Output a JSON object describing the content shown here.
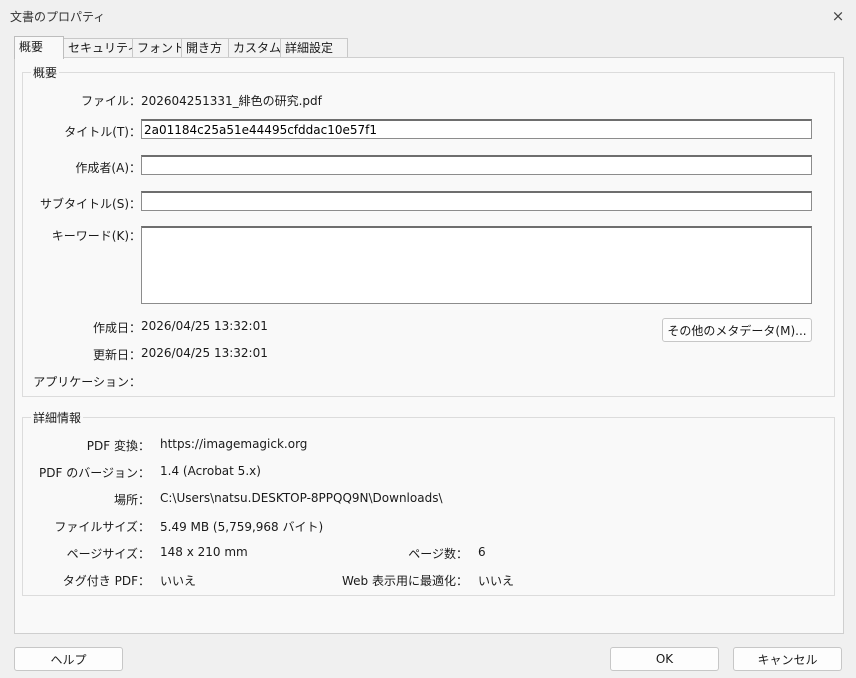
{
  "window": {
    "title": "文書のプロパティ",
    "close_icon": "×"
  },
  "tabs": [
    {
      "label": "概要"
    },
    {
      "label": "セキュリティ"
    },
    {
      "label": "フォント"
    },
    {
      "label": "開き方"
    },
    {
      "label": "カスタム"
    },
    {
      "label": "詳細設定"
    }
  ],
  "summary": {
    "group_label": "概要",
    "file_label": "ファイル：",
    "file_value": "202604251331_緋色の研究.pdf",
    "title_label": "タイトル(T)：",
    "title_value": "2a01184c25a51e44495cfddac10e57f1",
    "author_label": "作成者(A)：",
    "author_value": "",
    "subject_label": "サブタイトル(S)：",
    "subject_value": "",
    "keywords_label": "キーワード(K)：",
    "keywords_value": "",
    "created_label": "作成日：",
    "created_value": "2026/04/25 13:32:01",
    "modified_label": "更新日：",
    "modified_value": "2026/04/25 13:32:01",
    "application_label": "アプリケーション：",
    "application_value": "",
    "more_metadata_button": "その他のメタデータ(M)..."
  },
  "details": {
    "group_label": "詳細情報",
    "producer_label": "PDF 変換：",
    "producer_value": "https://imagemagick.org",
    "version_label": "PDF のバージョン：",
    "version_value": "1.4 (Acrobat 5.x)",
    "location_label": "場所：",
    "location_value": "C:\\Users\\natsu.DESKTOP-8PPQQ9N\\Downloads\\",
    "filesize_label": "ファイルサイズ：",
    "filesize_value": "5.49 MB (5,759,968 バイト)",
    "pagesize_label": "ページサイズ：",
    "pagesize_value": "148 x 210 mm",
    "pagecount_label": "ページ数：",
    "pagecount_value": "6",
    "tagged_label": "タグ付き PDF：",
    "tagged_value": "いいえ",
    "webview_label": "Web 表示用に最適化：",
    "webview_value": "いいえ"
  },
  "buttons": {
    "help": "ヘルプ",
    "ok": "OK",
    "cancel": "キャンセル"
  }
}
